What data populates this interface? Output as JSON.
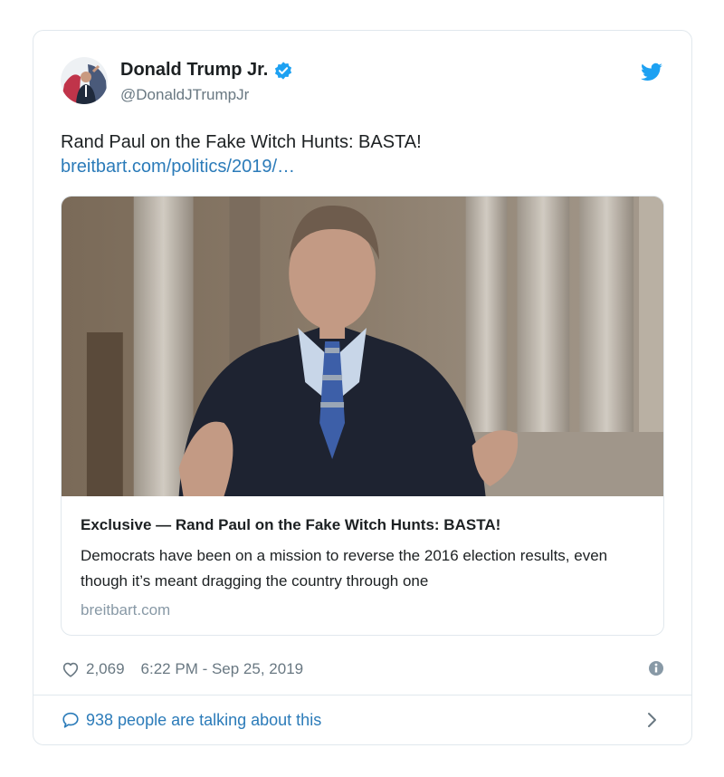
{
  "author": {
    "name": "Donald Trump Jr.",
    "handle": "@DonaldJTrumpJr"
  },
  "tweet": {
    "text": "Rand Paul on the Fake Witch Hunts: BASTA!",
    "link_text": "breitbart.com/politics/2019/…"
  },
  "card": {
    "title": "Exclusive — Rand Paul on the Fake Witch Hunts: BASTA!",
    "description": "Democrats have been on a mission to reverse the 2016 election results, even though it’s meant dragging the country through one",
    "domain": "breitbart.com"
  },
  "meta": {
    "likes": "2,069",
    "timestamp": "6:22 PM - Sep 25, 2019"
  },
  "talk": {
    "label": "938 people are talking about this"
  },
  "icons": {
    "verified": "verified-badge-icon",
    "bird": "twitter-bird-icon",
    "heart": "heart-icon",
    "info": "info-icon",
    "comment": "comment-bubble-icon",
    "chevron": "chevron-right-icon"
  },
  "colors": {
    "link": "#2b7bb9",
    "bird": "#1da1f2",
    "verified": "#1da1f2",
    "muted": "#697882",
    "border": "#e1e8ed"
  }
}
